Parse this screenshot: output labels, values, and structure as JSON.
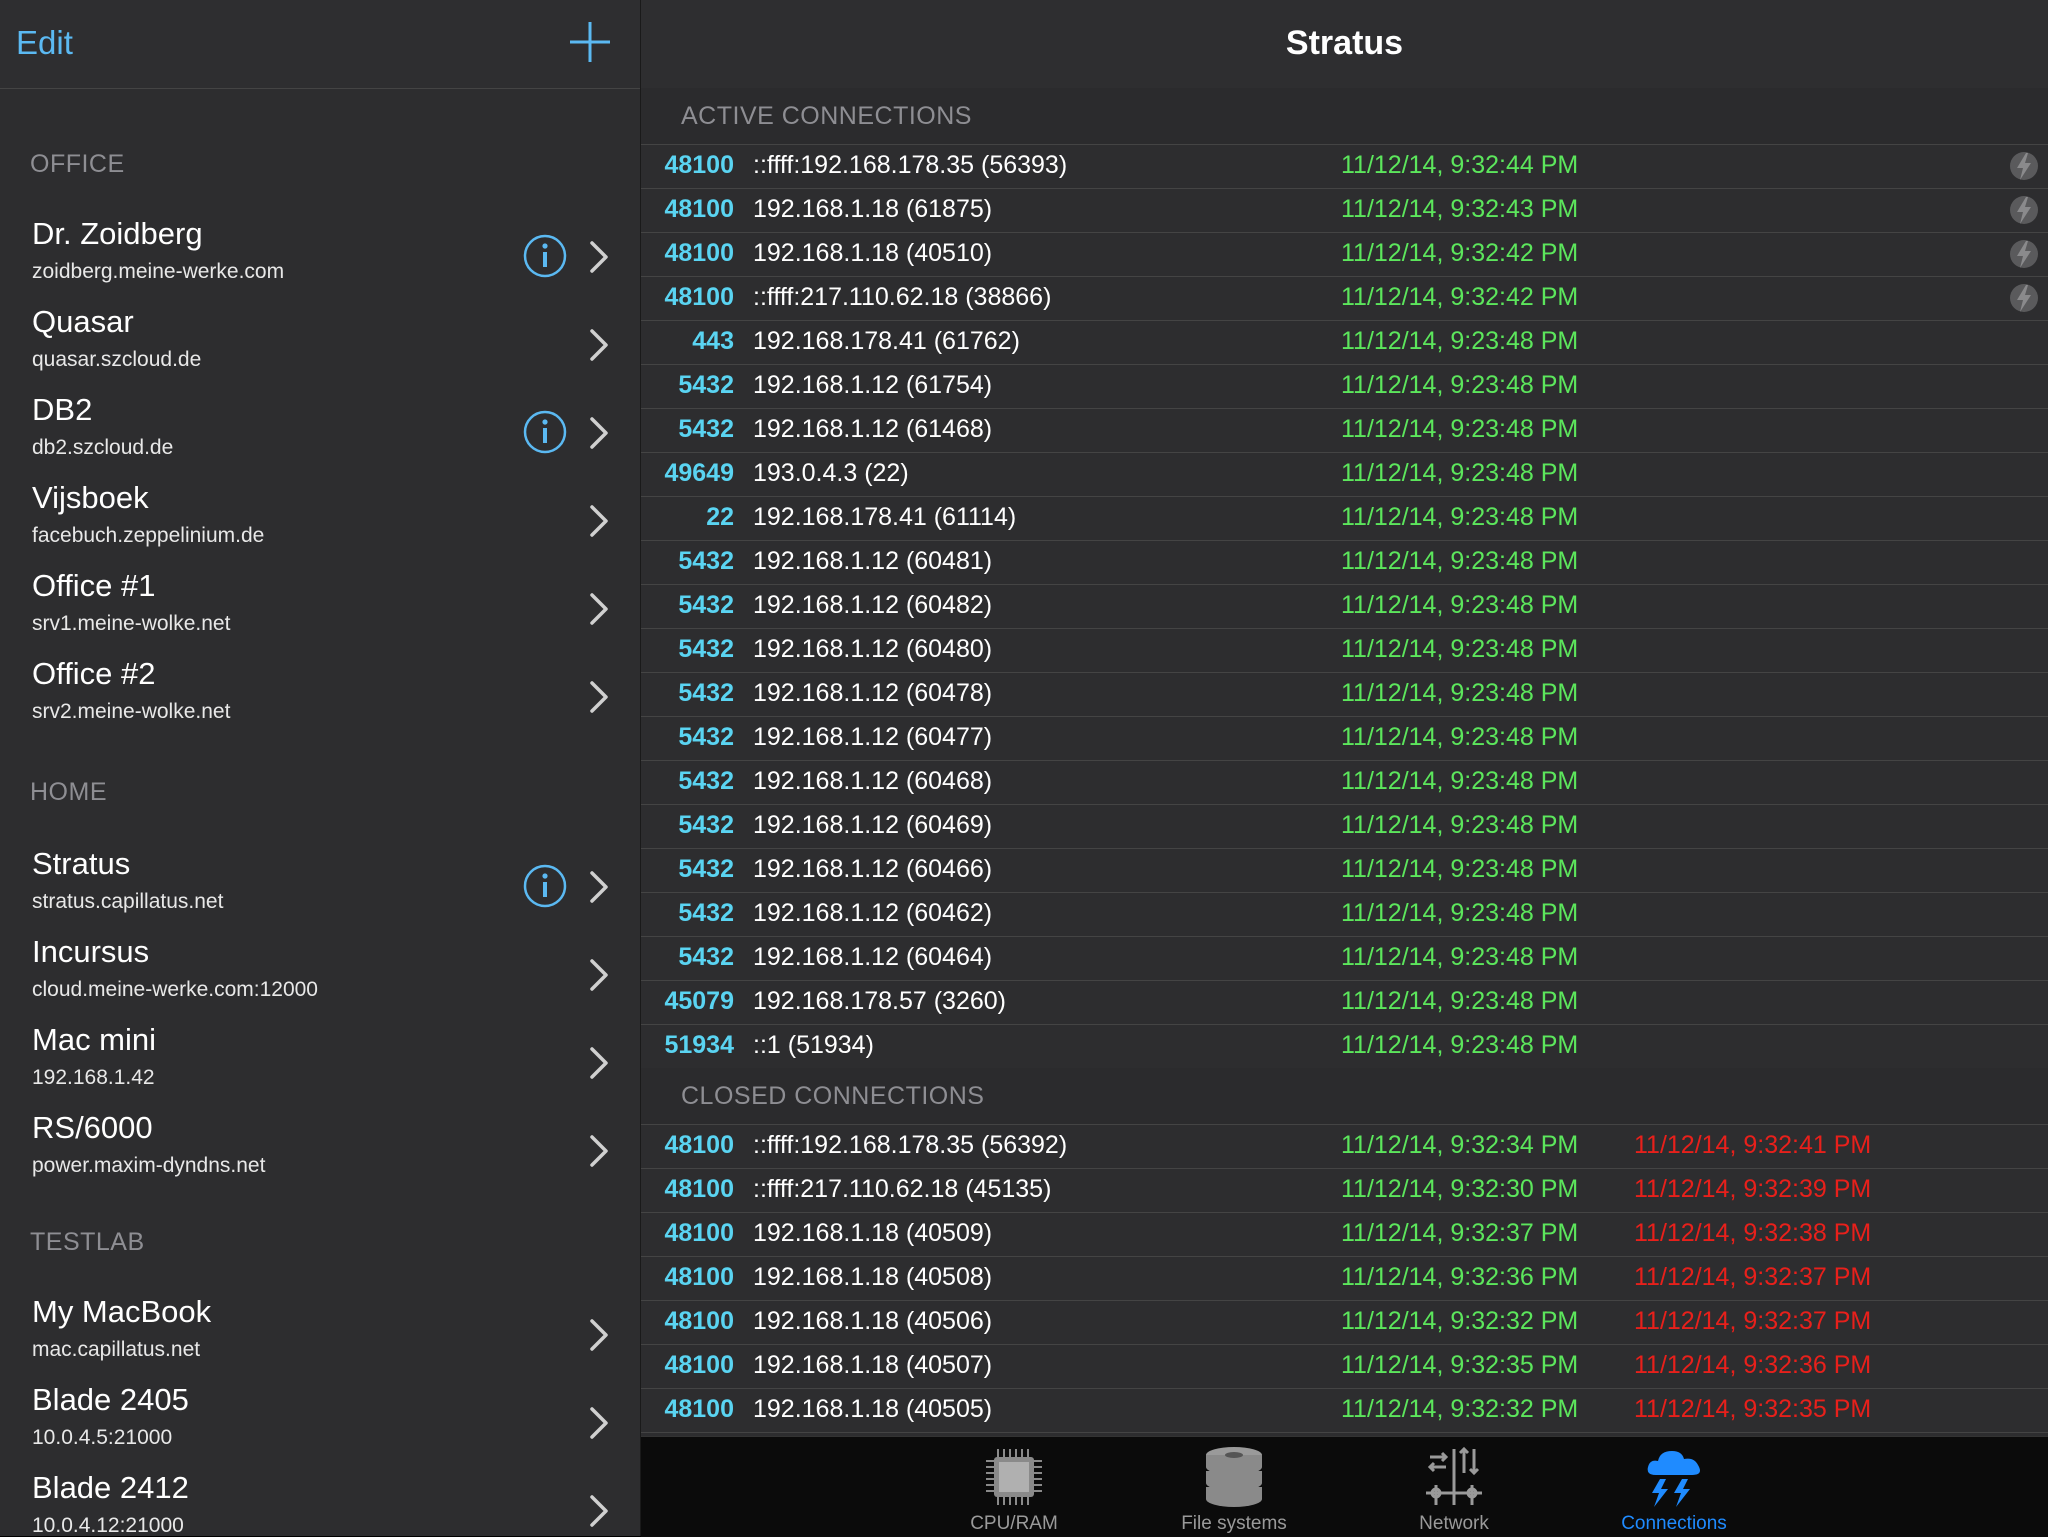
{
  "sidebar": {
    "edit_label": "Edit",
    "sections": [
      {
        "label": "OFFICE",
        "hosts": [
          {
            "name": "Dr. Zoidberg",
            "address": "zoidberg.meine-werke.com",
            "info": true
          },
          {
            "name": "Quasar",
            "address": "quasar.szcloud.de",
            "info": false
          },
          {
            "name": "DB2",
            "address": "db2.szcloud.de",
            "info": true
          },
          {
            "name": "Vijsboek",
            "address": "facebuch.zeppelinium.de",
            "info": false
          },
          {
            "name": "Office #1",
            "address": "srv1.meine-wolke.net",
            "info": false
          },
          {
            "name": "Office #2",
            "address": "srv2.meine-wolke.net",
            "info": false
          }
        ]
      },
      {
        "label": "HOME",
        "hosts": [
          {
            "name": "Stratus",
            "address": "stratus.capillatus.net",
            "info": true
          },
          {
            "name": "Incursus",
            "address": "cloud.meine-werke.com:12000",
            "info": false
          },
          {
            "name": "Mac mini",
            "address": "192.168.1.42",
            "info": false
          },
          {
            "name": "RS/6000",
            "address": "power.maxim-dyndns.net",
            "info": false
          }
        ]
      },
      {
        "label": "TESTLAB",
        "hosts": [
          {
            "name": "My MacBook",
            "address": "mac.capillatus.net",
            "info": false
          },
          {
            "name": "Blade 2405",
            "address": "10.0.4.5:21000",
            "info": false
          },
          {
            "name": "Blade 2412",
            "address": "10.0.4.12:21000",
            "info": false
          }
        ]
      }
    ]
  },
  "main": {
    "title": "Stratus",
    "active_label": "ACTIVE CONNECTIONS",
    "closed_label": "CLOSED CONNECTIONS",
    "active": [
      {
        "port": "48100",
        "addr": "::ffff:192.168.178.35 (56393)",
        "start": "11/12/14, 9:32:44 PM",
        "bolt": true
      },
      {
        "port": "48100",
        "addr": "192.168.1.18 (61875)",
        "start": "11/12/14, 9:32:43 PM",
        "bolt": true
      },
      {
        "port": "48100",
        "addr": "192.168.1.18 (40510)",
        "start": "11/12/14, 9:32:42 PM",
        "bolt": true
      },
      {
        "port": "48100",
        "addr": "::ffff:217.110.62.18 (38866)",
        "start": "11/12/14, 9:32:42 PM",
        "bolt": true
      },
      {
        "port": "443",
        "addr": "192.168.178.41 (61762)",
        "start": "11/12/14, 9:23:48 PM",
        "bolt": false
      },
      {
        "port": "5432",
        "addr": "192.168.1.12 (61754)",
        "start": "11/12/14, 9:23:48 PM",
        "bolt": false
      },
      {
        "port": "5432",
        "addr": "192.168.1.12 (61468)",
        "start": "11/12/14, 9:23:48 PM",
        "bolt": false
      },
      {
        "port": "49649",
        "addr": "193.0.4.3 (22)",
        "start": "11/12/14, 9:23:48 PM",
        "bolt": false
      },
      {
        "port": "22",
        "addr": "192.168.178.41 (61114)",
        "start": "11/12/14, 9:23:48 PM",
        "bolt": false
      },
      {
        "port": "5432",
        "addr": "192.168.1.12 (60481)",
        "start": "11/12/14, 9:23:48 PM",
        "bolt": false
      },
      {
        "port": "5432",
        "addr": "192.168.1.12 (60482)",
        "start": "11/12/14, 9:23:48 PM",
        "bolt": false
      },
      {
        "port": "5432",
        "addr": "192.168.1.12 (60480)",
        "start": "11/12/14, 9:23:48 PM",
        "bolt": false
      },
      {
        "port": "5432",
        "addr": "192.168.1.12 (60478)",
        "start": "11/12/14, 9:23:48 PM",
        "bolt": false
      },
      {
        "port": "5432",
        "addr": "192.168.1.12 (60477)",
        "start": "11/12/14, 9:23:48 PM",
        "bolt": false
      },
      {
        "port": "5432",
        "addr": "192.168.1.12 (60468)",
        "start": "11/12/14, 9:23:48 PM",
        "bolt": false
      },
      {
        "port": "5432",
        "addr": "192.168.1.12 (60469)",
        "start": "11/12/14, 9:23:48 PM",
        "bolt": false
      },
      {
        "port": "5432",
        "addr": "192.168.1.12 (60466)",
        "start": "11/12/14, 9:23:48 PM",
        "bolt": false
      },
      {
        "port": "5432",
        "addr": "192.168.1.12 (60462)",
        "start": "11/12/14, 9:23:48 PM",
        "bolt": false
      },
      {
        "port": "5432",
        "addr": "192.168.1.12 (60464)",
        "start": "11/12/14, 9:23:48 PM",
        "bolt": false
      },
      {
        "port": "45079",
        "addr": "192.168.178.57 (3260)",
        "start": "11/12/14, 9:23:48 PM",
        "bolt": false
      },
      {
        "port": "51934",
        "addr": "::1 (51934)",
        "start": "11/12/14, 9:23:48 PM",
        "bolt": false
      }
    ],
    "closed": [
      {
        "port": "48100",
        "addr": "::ffff:192.168.178.35 (56392)",
        "start": "11/12/14, 9:32:34 PM",
        "end": "11/12/14, 9:32:41 PM"
      },
      {
        "port": "48100",
        "addr": "::ffff:217.110.62.18 (45135)",
        "start": "11/12/14, 9:32:30 PM",
        "end": "11/12/14, 9:32:39 PM"
      },
      {
        "port": "48100",
        "addr": "192.168.1.18 (40509)",
        "start": "11/12/14, 9:32:37 PM",
        "end": "11/12/14, 9:32:38 PM"
      },
      {
        "port": "48100",
        "addr": "192.168.1.18 (40508)",
        "start": "11/12/14, 9:32:36 PM",
        "end": "11/12/14, 9:32:37 PM"
      },
      {
        "port": "48100",
        "addr": "192.168.1.18 (40506)",
        "start": "11/12/14, 9:32:32 PM",
        "end": "11/12/14, 9:32:37 PM"
      },
      {
        "port": "48100",
        "addr": "192.168.1.18 (40507)",
        "start": "11/12/14, 9:32:35 PM",
        "end": "11/12/14, 9:32:36 PM"
      },
      {
        "port": "48100",
        "addr": "192.168.1.18 (40505)",
        "start": "11/12/14, 9:32:32 PM",
        "end": "11/12/14, 9:32:35 PM"
      }
    ]
  },
  "tabs": [
    {
      "label": "CPU/RAM",
      "icon": "cpu-icon",
      "active": false
    },
    {
      "label": "File systems",
      "icon": "disk-stack-icon",
      "active": false
    },
    {
      "label": "Network",
      "icon": "network-icon",
      "active": false
    },
    {
      "label": "Connections",
      "icon": "cloud-lightning-icon",
      "active": true
    }
  ],
  "colors": {
    "accent": "#5bb9f2",
    "port": "#5ad4f2",
    "start_time": "#5ce65c",
    "end_time": "#e8201b",
    "active_tab": "#1f8bff"
  }
}
